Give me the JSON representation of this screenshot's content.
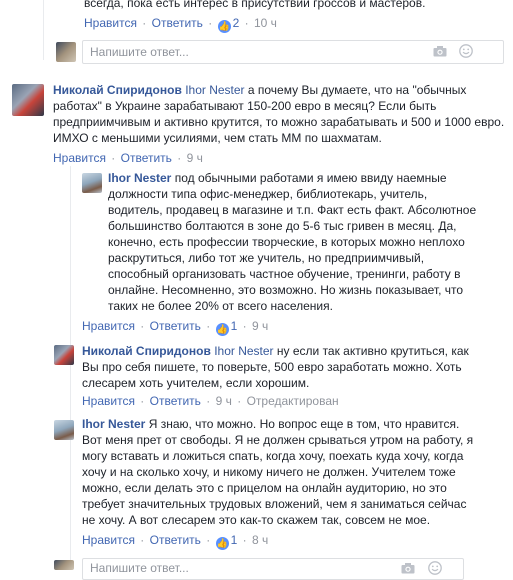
{
  "top_comment": {
    "tail_text": "всегда, пока есть интерес в присутствии гроссов и мастеров.",
    "like_label": "Нравится",
    "reply_label": "Ответить",
    "like_count": "2",
    "time": "10 ч"
  },
  "reply_box_1": {
    "placeholder": "Напишите ответ..."
  },
  "comment_nikolay_1": {
    "author": "Николай Спиридонов",
    "mention": "Ihor Nester",
    "text": "а почему Вы думаете, что на \"обычных работах\" в Украине зарабатывают 150-200 евро в месяц? Если быть предприимчивым и активно крутится, то можно зарабатывать и 500 и 1000 евро. ИМХО с меньшими усилиями, чем стать ММ по шахматам.",
    "like_label": "Нравится",
    "reply_label": "Ответить",
    "time": "9 ч"
  },
  "reply_ihor_1": {
    "author": "Ihor Nester",
    "text": "под обычными работами я имею ввиду наемные должности типа офис-менеджер, библиотекарь, учитель, водитель, продавец в магазине и т.п. Факт есть факт. Абсолютное большинство болтаются в зоне до 5-6 тыс гривен в месяц. Да, конечно, есть профессии творческие, в которых можно неплохо раскрутиться, либо тот же учитель, но предприимчивый, способный организовать частное обучение, тренинги, работу в онлайне. Несомненно, это возможно. Но жизнь показывает, что таких не более 20% от всего населения.",
    "like_label": "Нравится",
    "reply_label": "Ответить",
    "like_count": "1",
    "time": "9 ч"
  },
  "reply_nikolay_2": {
    "author": "Николай Спиридонов",
    "mention": "Ihor Nester",
    "text": "ну если так активно крутиться, как Вы про себя пишете, то поверьте, 500 евро заработать можно. Хоть слесарем хоть учителем, если хорошим.",
    "like_label": "Нравится",
    "reply_label": "Ответить",
    "time": "9 ч",
    "edited": "Отредактирован"
  },
  "reply_ihor_2": {
    "author": "Ihor Nester",
    "text": "Я знаю, что можно. Но вопрос еще в том, что нравится. Вот меня прет от свободы. Я не должен срываться утром на работу, я могу вставать и ложиться спать, когда хочу, поехать куда хочу, когда хочу и на сколько хочу, и никому ничего не должен. Учителем тоже можно, если делать это с прицелом на онлайн аудиторию, но это требует значительных трудовых вложений, чем я заниматься сейчас не хочу. А вот слесарем это как-то скажем так, совсем не мое.",
    "like_label": "Нравится",
    "reply_label": "Ответить",
    "like_count": "1",
    "time": "8 ч"
  },
  "reply_box_2": {
    "placeholder": "Напишите ответ..."
  },
  "icons": {
    "like": "thumbs-up-icon",
    "camera": "camera-icon",
    "emoji": "smile-icon"
  },
  "colors": {
    "link": "#365899",
    "action": "#4267b2",
    "meta": "#90949c",
    "like_badge": "#5890ff"
  }
}
